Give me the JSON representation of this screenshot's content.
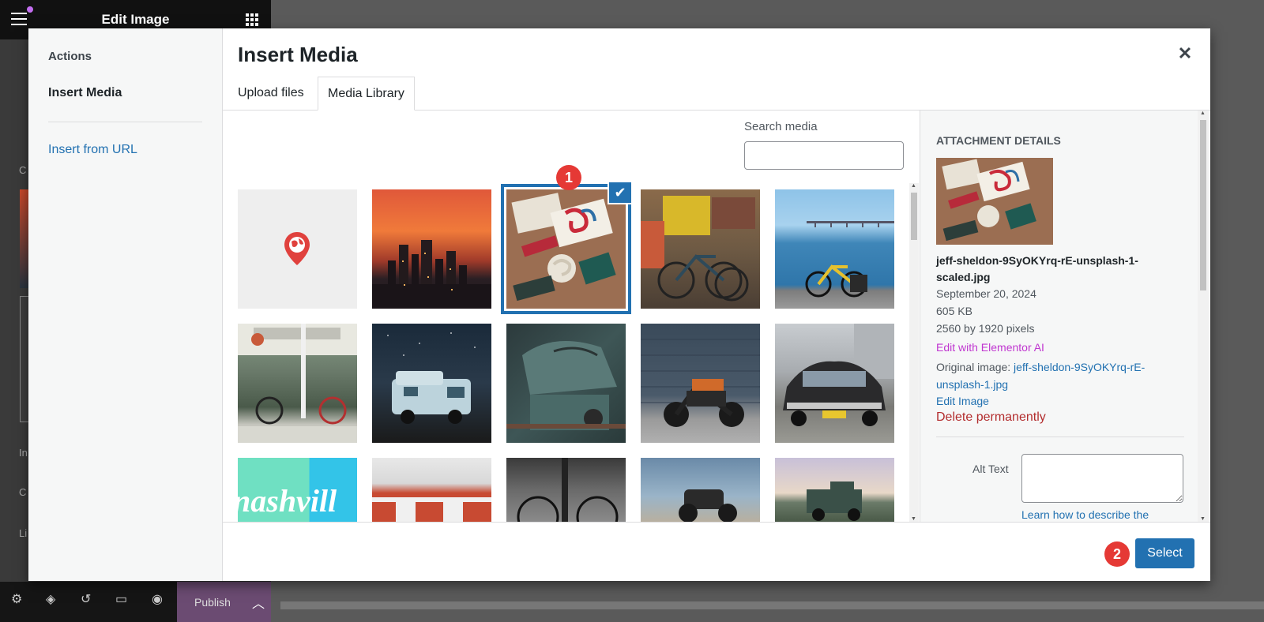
{
  "editor": {
    "title": "Edit Image",
    "publish_label": "Publish",
    "side_letters": [
      "C",
      "In",
      "C",
      "Li"
    ]
  },
  "modal": {
    "title": "Insert Media",
    "close_glyph": "✕"
  },
  "sidebar": {
    "actions_label": "Actions",
    "insert_media_label": "Insert Media",
    "insert_from_url_label": "Insert from URL"
  },
  "tabs": {
    "upload_label": "Upload files",
    "library_label": "Media Library"
  },
  "search": {
    "label": "Search media",
    "value": "",
    "placeholder": ""
  },
  "grid": {
    "selected_check": "✔"
  },
  "details": {
    "heading": "Attachment Details",
    "filename": "jeff-sheldon-9SyOKYrq-rE-unsplash-1-scaled.jpg",
    "date": "September 20, 2024",
    "size": "605 KB",
    "dimensions": "2560 by 1920 pixels",
    "edit_ai_label": "Edit with Elementor AI",
    "original_label": "Original image:",
    "original_link": "jeff-sheldon-9SyOKYrq-rE-unsplash-1.jpg",
    "edit_image_label": "Edit Image",
    "delete_label": "Delete permanently",
    "alt_text_label": "Alt Text",
    "alt_text_value": "",
    "learn_label": "Learn how to describe the"
  },
  "toolbar": {
    "select_label": "Select"
  },
  "markers": {
    "one": "1",
    "two": "2"
  },
  "colors": {
    "primary": "#2271b1",
    "delete": "#b32d2e",
    "ai": "#c036d0",
    "marker": "#e53935"
  }
}
